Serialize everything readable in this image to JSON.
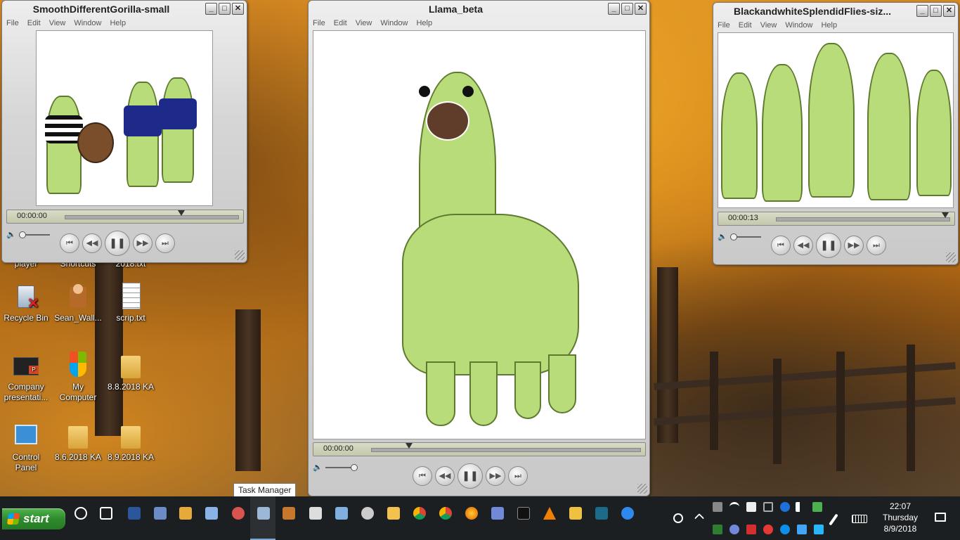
{
  "desktop": {
    "icons": [
      {
        "label": "player",
        "partial": true
      },
      {
        "label": "Shortcuts",
        "partial": true
      },
      {
        "label": "2018.txt",
        "partial": true
      },
      {
        "label": "Recycle Bin"
      },
      {
        "label": "Sean_Wall..."
      },
      {
        "label": "scrip.txt"
      },
      {
        "label": "Company presentati..."
      },
      {
        "label": "My Computer"
      },
      {
        "label": "8.8.2018 KA"
      },
      {
        "label": "Control Panel"
      },
      {
        "label": "8.6.2018 KA"
      },
      {
        "label": "8.9.2018 KA"
      }
    ]
  },
  "menu": [
    "File",
    "Edit",
    "View",
    "Window",
    "Help"
  ],
  "window_buttons": {
    "minimize": "_",
    "maximize": "□",
    "close": "✕"
  },
  "player_controls": {
    "prev": "⏮",
    "rewind": "◀◀",
    "pause": "❚❚",
    "forward": "▶▶",
    "next": "⏭",
    "speaker": "🔈"
  },
  "windows": [
    {
      "title": "SmoothDifferentGorilla-small",
      "timecode": "00:00:00",
      "progress": 0.67
    },
    {
      "title": "Llama_beta",
      "timecode": "00:00:00",
      "progress": 0.14
    },
    {
      "title": "BlackandwhiteSplendidFlies-siz...",
      "timecode": "00:00:13",
      "progress": 0.97
    }
  ],
  "tooltip": "Task Manager",
  "taskbar": {
    "start_label": "start",
    "clock_time": "22:07",
    "clock_day": "Thursday",
    "clock_date": "8/9/2018",
    "icons": [
      "cortana-icon",
      "task-view-icon",
      "word-icon",
      "app-icon",
      "paint-icon",
      "doc-icon",
      "paint2-icon",
      "display-icon",
      "film-icon",
      "calculator-icon",
      "notes-icon",
      "settings-icon",
      "file-explorer-icon",
      "chrome-icon",
      "chrome2-icon",
      "firefox-icon",
      "discord-icon",
      "cmd-icon",
      "vlc-icon",
      "app2-icon",
      "book-icon",
      "edge-icon"
    ]
  },
  "colors": {
    "accent": "#7aa7d6",
    "start_green": "#2f8a2c",
    "llama_green": "#b9dc7a",
    "taskbar": "#1c1f22"
  }
}
